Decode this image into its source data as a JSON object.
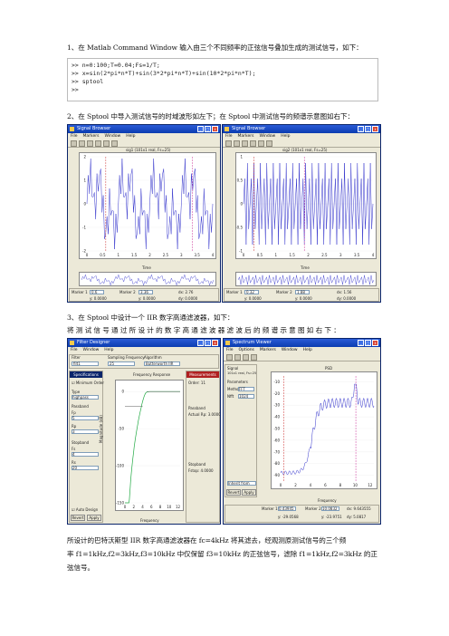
{
  "doc": {
    "step1": "1、在 Matlab Command Window 输入由三个不同频率的正弦信号叠加生成的测试信号，如下：",
    "code_lines": [
      ">>  n=0:100;T=0.04;Fs=1/T;",
      ">>  x=sin(2*pi*n*T)+sin(3*2*pi*n*T)+sin(10*2*pi*n*T);",
      ">>  sptool",
      ">>"
    ],
    "step2": "2、在 Sptool 中导入测试信号的时域波形如左下；在 Sptool 中测试信号的频谱示意图如右下：",
    "step3": "3、在 Sptool 中设计一个 IIR 数字高通滤波器，如下：",
    "step3b": "将 测 试 信 号 通 过 所 设 计 的 数 字 高 通 滤 波 器 滤 波 后 的 频 谱 示 意 图 如 右 下 ：",
    "conclusion_1": "所设计的巴特沃斯型 IIR 数字高通滤波器在 fc=4kHz 将其滤去，经观测原测试信号的三个频",
    "conclusion_2": "率 f1=1kHz,f2=3kHz,f3=10kHz 中仅保留 f3=10kHz 的正弦信号，滤除 f1=1kHz,f2=3kHz 的正",
    "conclusion_3": "弦信号。"
  },
  "win1": {
    "title": "Signal Browser",
    "menu": [
      "File",
      "Markers",
      "Window",
      "Help"
    ],
    "plot_title": "sig1 (101x1 real, Fs=25)",
    "xlabel": "Time",
    "xticks": [
      "0",
      "0.5",
      "1",
      "1.5",
      "2",
      "2.5",
      "3",
      "3.5",
      "4"
    ],
    "yticks": [
      "2",
      "1",
      "0",
      "-1",
      "-2"
    ],
    "marker1_label": "Marker 1",
    "marker1_val": "0.6",
    "marker2_label": "Marker 2",
    "marker2_val": "3.36",
    "dx": "dx: 2.76",
    "y1": "y: 0.0000",
    "y2": "y: 0.0000",
    "dy": "dy: 0.0000"
  },
  "win2": {
    "title": "Signal Browser",
    "menu": [
      "File",
      "Markers",
      "Window",
      "Help"
    ],
    "plot_title": "sig2 (101x1 real, Fs=25)",
    "xlabel": "Time",
    "xticks": [
      "0",
      "0.5",
      "1",
      "1.5",
      "2",
      "2.5",
      "3",
      "3.5",
      "4"
    ],
    "yticks": [
      "1",
      "0.5",
      "0",
      "-0.5",
      "-1"
    ],
    "marker1_label": "Marker 1",
    "marker1_val": "0.32",
    "marker2_label": "Marker 2",
    "marker2_val": "1.88",
    "dx": "dx: 1.56",
    "y1": "y: 0.0000",
    "y2": "y: 0.0000",
    "dy": "dy: 0.0000"
  },
  "win3": {
    "title": "Filter Designer",
    "menu": [
      "File",
      "Window",
      "Help"
    ],
    "filter_label": "Filter",
    "filter_val": "filt1",
    "fs_label": "Sampling Frequency",
    "fs_val": "25",
    "algo_label": "Algorithm",
    "algo_val": "Butterworth IIR",
    "spec_header": "Specifications",
    "minimum_order": "Minimum Order",
    "type_label": "Type",
    "type_val": "highpass",
    "passband": "Passband",
    "fp_label": "Fp",
    "fp_val": "5",
    "rp_label": "Rp",
    "rp_val": "3",
    "stopband": "Stopband",
    "fs2_label": "Fs",
    "fs2_val": "4",
    "rs_label": "Rs",
    "rs_val": "20",
    "auto_design": "Auto Design",
    "revert": "Revert",
    "apply": "Apply",
    "plot_title": "Frequency Response",
    "xlabel": "Frequency",
    "ylabel": "Magnitude (dB)",
    "xticks": [
      "0",
      "2",
      "4",
      "6",
      "8",
      "10",
      "12"
    ],
    "yticks": [
      "0",
      "-50",
      "-100",
      "-150"
    ],
    "meas_header": "Measurements",
    "order_label": "Order: 11",
    "passband2": "Passband",
    "actual_rp": "Actual Rp: 3.0000",
    "stopband2": "Stopband",
    "actual_rs": "Fstop: 4.0000"
  },
  "win4": {
    "title": "Spectrum Viewer",
    "menu": [
      "File",
      "Options",
      "Markers",
      "Window",
      "Help"
    ],
    "signal_label": "Signal",
    "signal_info": "101x1 real, Fs=25",
    "param_label": "Parameters",
    "method_label": "Method",
    "method_val": "FFT",
    "nfft_label": "Nfft",
    "nfft_val": "1024",
    "plot_title": "PSD",
    "xlabel": "Frequency",
    "xticks": [
      "0",
      "2",
      "4",
      "6",
      "8",
      "10",
      "12"
    ],
    "yticks": [
      "-10",
      "-20",
      "-30",
      "-40",
      "-50",
      "-60",
      "-70",
      "-80",
      "-90"
    ],
    "inherit_from": "Inherit from",
    "revert": "Revert",
    "apply": "Apply",
    "marker1_label": "Marker 1",
    "marker1_val": "0.43945",
    "marker2_label": "Marker 2",
    "marker2_val": "10.0832",
    "y1": "y: -29.0568",
    "y2": "y: -23.9751",
    "dx": "dx: 9.643555",
    "dy": "dy: 5.0817"
  },
  "colors": {
    "signal_line": "#3333cc",
    "marker1": "#cc3333",
    "marker2": "#cc3399",
    "response_line": "#22aa44"
  }
}
